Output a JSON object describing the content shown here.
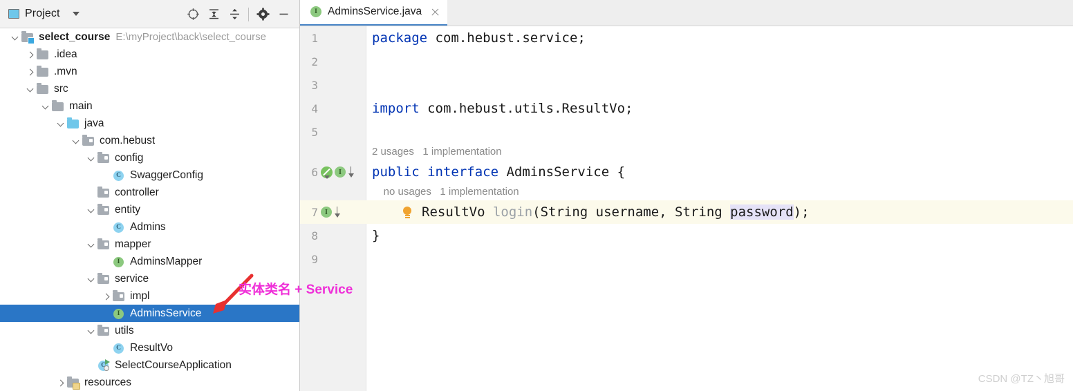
{
  "window": {
    "watermark": "CSDN @TZ丶旭哥"
  },
  "sidebar": {
    "title": "Project",
    "title_icon": "project-panel-icon",
    "dropdown_icon": "chevron-down-icon",
    "toolbar_buttons": [
      {
        "name": "select-opened-file-icon",
        "label": "Select Opened File"
      },
      {
        "name": "expand-all-icon",
        "label": "Expand All"
      },
      {
        "name": "collapse-all-icon",
        "label": "Collapse All"
      },
      {
        "name": "settings-gear-icon",
        "label": "Settings"
      },
      {
        "name": "hide-panel-icon",
        "label": "Hide"
      }
    ],
    "tree": [
      {
        "label": "select_course",
        "path": "E:\\myProject\\back\\select_course",
        "icon": "module-folder-icon",
        "indent": 0,
        "twisty": "open",
        "bold": true,
        "selected": false
      },
      {
        "label": ".idea",
        "path": "",
        "icon": "folder-icon",
        "indent": 1,
        "twisty": "closed",
        "bold": false,
        "selected": false
      },
      {
        "label": ".mvn",
        "path": "",
        "icon": "folder-icon",
        "indent": 1,
        "twisty": "closed",
        "bold": false,
        "selected": false
      },
      {
        "label": "src",
        "path": "",
        "icon": "folder-icon",
        "indent": 1,
        "twisty": "open",
        "bold": false,
        "selected": false
      },
      {
        "label": "main",
        "path": "",
        "icon": "folder-icon",
        "indent": 2,
        "twisty": "open",
        "bold": false,
        "selected": false
      },
      {
        "label": "java",
        "path": "",
        "icon": "source-folder-icon",
        "indent": 3,
        "twisty": "open",
        "bold": false,
        "selected": false
      },
      {
        "label": "com.hebust",
        "path": "",
        "icon": "package-folder-icon",
        "indent": 4,
        "twisty": "open",
        "bold": false,
        "selected": false
      },
      {
        "label": "config",
        "path": "",
        "icon": "package-folder-icon",
        "indent": 5,
        "twisty": "open",
        "bold": false,
        "selected": false
      },
      {
        "label": "SwaggerConfig",
        "path": "",
        "icon": "java-class-icon",
        "indent": 6,
        "twisty": "none",
        "bold": false,
        "selected": false
      },
      {
        "label": "controller",
        "path": "",
        "icon": "package-folder-icon",
        "indent": 5,
        "twisty": "none",
        "bold": false,
        "selected": false
      },
      {
        "label": "entity",
        "path": "",
        "icon": "package-folder-icon",
        "indent": 5,
        "twisty": "open",
        "bold": false,
        "selected": false
      },
      {
        "label": "Admins",
        "path": "",
        "icon": "java-class-icon",
        "indent": 6,
        "twisty": "none",
        "bold": false,
        "selected": false
      },
      {
        "label": "mapper",
        "path": "",
        "icon": "package-folder-icon",
        "indent": 5,
        "twisty": "open",
        "bold": false,
        "selected": false
      },
      {
        "label": "AdminsMapper",
        "path": "",
        "icon": "java-interface-icon",
        "indent": 6,
        "twisty": "none",
        "bold": false,
        "selected": false
      },
      {
        "label": "service",
        "path": "",
        "icon": "package-folder-icon",
        "indent": 5,
        "twisty": "open",
        "bold": false,
        "selected": false
      },
      {
        "label": "impl",
        "path": "",
        "icon": "package-folder-icon",
        "indent": 6,
        "twisty": "closed",
        "bold": false,
        "selected": false
      },
      {
        "label": "AdminsService",
        "path": "",
        "icon": "java-interface-icon",
        "indent": 6,
        "twisty": "none",
        "bold": false,
        "selected": true
      },
      {
        "label": "utils",
        "path": "",
        "icon": "package-folder-icon",
        "indent": 5,
        "twisty": "open",
        "bold": false,
        "selected": false
      },
      {
        "label": "ResultVo",
        "path": "",
        "icon": "java-class-icon",
        "indent": 6,
        "twisty": "none",
        "bold": false,
        "selected": false
      },
      {
        "label": "SelectCourseApplication",
        "path": "",
        "icon": "spring-boot-class-icon",
        "indent": 5,
        "twisty": "none",
        "bold": false,
        "selected": false
      },
      {
        "label": "resources",
        "path": "",
        "icon": "resources-folder-icon",
        "indent": 3,
        "twisty": "closed",
        "bold": false,
        "selected": false
      }
    ]
  },
  "editor": {
    "tab": {
      "label": "AdminsService.java",
      "icon": "java-interface-icon",
      "close_icon": "close-icon"
    },
    "lines": [
      {
        "num": "1",
        "hint": "",
        "highlight": false,
        "gutter": [],
        "segments": [
          {
            "text": "package ",
            "style": "kw"
          },
          {
            "text": "com.hebust.service;",
            "style": "plain"
          }
        ]
      },
      {
        "num": "2",
        "hint": "",
        "highlight": false,
        "gutter": [],
        "segments": []
      },
      {
        "num": "3",
        "hint": "",
        "highlight": false,
        "gutter": [],
        "segments": []
      },
      {
        "num": "4",
        "hint": "",
        "highlight": false,
        "gutter": [],
        "segments": [
          {
            "text": "import ",
            "style": "kw"
          },
          {
            "text": "com.hebust.utils.ResultVo;",
            "style": "plain"
          }
        ]
      },
      {
        "num": "5",
        "hint": "",
        "highlight": false,
        "gutter": [],
        "segments": []
      },
      {
        "num": "6",
        "hint": "2 usages   1 implementation",
        "highlight": false,
        "gutter": [
          "spring-bean-icon",
          "implemented-by-icon"
        ],
        "segments": [
          {
            "text": "public ",
            "style": "kw"
          },
          {
            "text": "interface ",
            "style": "kw"
          },
          {
            "text": "AdminsService {",
            "style": "plain"
          }
        ]
      },
      {
        "num": "7",
        "hint": "    no usages   1 implementation",
        "highlight": true,
        "gutter": [
          "implemented-by-icon"
        ],
        "segments": [
          {
            "text": "ResultVo ",
            "style": "plain"
          },
          {
            "text": "login",
            "style": "gray"
          },
          {
            "text": "(String username, String ",
            "style": "plain"
          },
          {
            "text": "password",
            "style": "selected"
          },
          {
            "text": ");",
            "style": "plain"
          }
        ]
      },
      {
        "num": "8",
        "hint": "",
        "highlight": false,
        "gutter": [],
        "segments": [
          {
            "text": "}",
            "style": "plain"
          }
        ]
      },
      {
        "num": "9",
        "hint": "",
        "highlight": false,
        "gutter": [],
        "segments": []
      }
    ]
  },
  "annotation": {
    "text": "实体类名 + Service",
    "arrow_color": "#e83030",
    "text_color": "#ef2fd8"
  },
  "colors": {
    "selection_blue": "#2a76c6",
    "keyword_blue": "#0033b3",
    "line_highlight": "#fcfaeb",
    "token_highlight": "#e5e2f7",
    "interface_green": "#8cc97f",
    "class_blue": "#8ed3f0"
  }
}
